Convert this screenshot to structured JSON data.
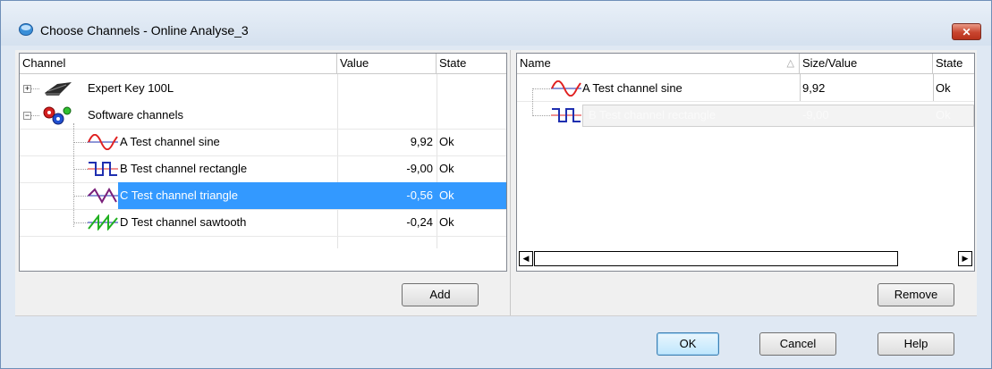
{
  "window": {
    "title": "Choose Channels - Online Analyse_3",
    "close_label": "✕"
  },
  "left": {
    "columns": [
      "Channel",
      "Value",
      "State"
    ],
    "groups": [
      {
        "label": "Expert Key 100L",
        "expander": "+",
        "icon": "device-icon"
      },
      {
        "label": "Software channels",
        "expander": "−",
        "icon": "gears-icon"
      }
    ],
    "channels": [
      {
        "label": "A Test channel sine",
        "value": "9,92",
        "state": "Ok",
        "icon": "sine-wave-icon",
        "color": "#e02020"
      },
      {
        "label": "B Test channel rectangle",
        "value": "-9,00",
        "state": "Ok",
        "icon": "rectangle-wave-icon",
        "color": "#1f2fb0"
      },
      {
        "label": "C Test channel triangle",
        "value": "-0,56",
        "state": "Ok",
        "icon": "triangle-wave-icon",
        "color": "#7a1f7a"
      },
      {
        "label": "D Test channel sawtooth",
        "value": "-0,24",
        "state": "Ok",
        "icon": "sawtooth-wave-icon",
        "color": "#20b020"
      }
    ],
    "selected_index": 2,
    "add_label": "Add"
  },
  "right": {
    "columns": [
      "Name",
      "Size/Value",
      "State"
    ],
    "sort_indicator": "△",
    "rows": [
      {
        "label": "A Test channel sine",
        "value": "9,92",
        "state": "Ok",
        "icon": "sine-wave-icon"
      },
      {
        "label": "B Test channel rectangle",
        "value": "-9,00",
        "state": "Ok",
        "icon": "rectangle-wave-icon"
      }
    ],
    "remove_label": "Remove",
    "scroll_left": "◀",
    "scroll_right": "▶"
  },
  "buttons": {
    "ok": "OK",
    "cancel": "Cancel",
    "help": "Help"
  },
  "colors": {
    "selection": "#3399ff",
    "title_gradient_top": "#e9f0f8",
    "close_red": "#c8452f"
  }
}
